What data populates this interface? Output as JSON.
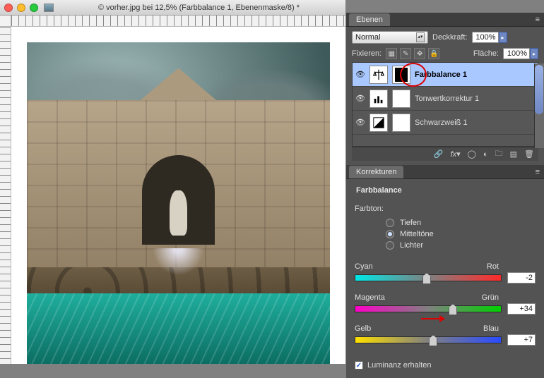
{
  "window": {
    "title": "© vorher.jpg bei 12,5% (Farbbalance 1, Ebenenmaske/8) *"
  },
  "ebenen": {
    "tab": "Ebenen",
    "blend_mode": "Normal",
    "opacity_label": "Deckkraft:",
    "opacity_value": "100%",
    "lock_label": "Fixieren:",
    "fill_label": "Fläche:",
    "fill_value": "100%",
    "layers": [
      {
        "name": "Farbbalance 1",
        "selected": true,
        "adj_icon": "balance",
        "mask": "black-mid"
      },
      {
        "name": "Tonwertkorrektur 1",
        "selected": false,
        "adj_icon": "levels",
        "mask": "white"
      },
      {
        "name": "Schwarzweiß 1",
        "selected": false,
        "adj_icon": "bw",
        "mask": "white"
      }
    ],
    "footer_icons": [
      "link",
      "fx",
      "mask",
      "adj",
      "group",
      "new",
      "trash"
    ]
  },
  "korrekturen": {
    "tab": "Korrekturen",
    "heading": "Farbbalance",
    "tone_label": "Farbton:",
    "tones": [
      {
        "label": "Tiefen",
        "checked": false
      },
      {
        "label": "Mitteltöne",
        "checked": true
      },
      {
        "label": "Lichter",
        "checked": false
      }
    ],
    "sliders": [
      {
        "left": "Cyan",
        "right": "Rot",
        "value": "-2",
        "pos": 49
      },
      {
        "left": "Magenta",
        "right": "Grün",
        "value": "+34",
        "pos": 67,
        "arrow": true
      },
      {
        "left": "Gelb",
        "right": "Blau",
        "value": "+7",
        "pos": 53.5
      }
    ],
    "preserve_lum": {
      "label": "Luminanz erhalten",
      "checked": true
    }
  }
}
